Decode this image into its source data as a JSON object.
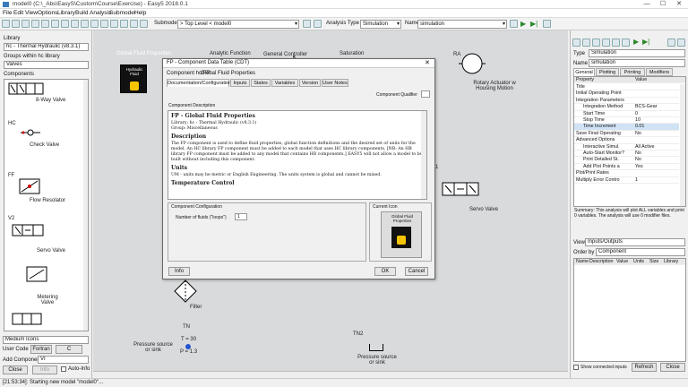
{
  "window": {
    "title": "model0 (C:\\_Abs\\EasyS\\Custom\\Course\\Exercise) - Easy5 2018.0.1",
    "minimize": "—",
    "maximize": "☐",
    "close": "✕"
  },
  "menu": [
    "File",
    "Edit",
    "View",
    "Options",
    "Library",
    "Build",
    "Analysis",
    "Submodel",
    "Help"
  ],
  "toolbar": {
    "submodel_label": "Submodel",
    "submodel_value": "> Top Level < model0",
    "analysis_type_label": "Analysis Type",
    "analysis_type_value": "Simulation",
    "name_label": "Name",
    "name_value": "simulation"
  },
  "left": {
    "library_label": "Library",
    "library_value": "hc - Thermal Hydraulic (v8.3.1)",
    "groups_label": "Groups within hc library",
    "groups_value": "Valves",
    "components_label": "Components",
    "components": [
      {
        "code": "",
        "name": "8-Way Valve"
      },
      {
        "code": "HC",
        "name": "Check Valve"
      },
      {
        "code": "FF",
        "name": "Flow Resolator"
      },
      {
        "code": "V2",
        "name": "Servo Valve"
      },
      {
        "code": "",
        "name": "Metering Valve"
      }
    ],
    "icon_size": "Medium Icons",
    "user_code_label": "User Code",
    "fortran": "Fortran",
    "c": "C",
    "add_component_label": "Add Component",
    "add_component_value": "VI",
    "close": "Close",
    "info": "Info",
    "auto_info": "Auto-Info"
  },
  "canvas": {
    "labels": {
      "analytic": "Analytic Function",
      "general_controller": "General Controller",
      "saturation": "Saturation",
      "hydraulic_fluid_props": "Global Fluid Properties",
      "rotary_actuator": "Rotary Actuator w Housing Motion",
      "servo_valve": "Servo Valve",
      "filter": "Filter",
      "pressure_source_1": "Pressure source or sink",
      "pressure_source_2": "Pressure source or sink",
      "t_value": "T = 30",
      "p_value": "P = 1.3",
      "fp_code": "FP",
      "ra_code": "RA",
      "v1_code": "V1",
      "tn_code": "TN",
      "tn2_code": "TN2",
      "fluid_text": "Hydraulic Fluid"
    }
  },
  "dialog": {
    "title": "FP - Component Data Table (CDT)",
    "component_label": "Component hc/FP",
    "component_name": "Global Fluid Properties",
    "tabs": [
      "Documentation/Configuration",
      "Inputs",
      "States",
      "Variables",
      "Version",
      "User Notes"
    ],
    "qualifier_label": "Component Qualifier",
    "desc_label": "Component Description",
    "desc_heading": "FP - Global Fluid Properties",
    "desc_library": "Library: hc - Thermal Hydraulic (v8.3.1)",
    "desc_group": "Group: Miscellaneous",
    "desc_section": "Description",
    "desc_body": "The FP component is used to define fluid properties, global function definitions and the desired set of units for the model. An HC library FP component must be added to each model that uses HC library components. [NB: An HB library FP component must be added to any model that contains HB components.] EASY5 will not allow a model to be built without including this component.",
    "desc_units_section": "Units",
    "desc_units": "UM - units may be metric or English Engineering. The units system is global and cannot be mixed.",
    "desc_temp": "Temperature Control",
    "config_label": "Component Configuration",
    "num_fluids_label": "Number of fluids (\"loops\")",
    "num_fluids_value": "1",
    "current_icon_label": "Current Icon",
    "icon_caption": "Global Fluid Properties",
    "info": "Info",
    "ok": "OK",
    "cancel": "Cancel"
  },
  "right": {
    "type_label": "Type",
    "type_value": "Simulation",
    "name_label": "Name",
    "name_value": "simulation",
    "tabs": [
      "General",
      "Plotting",
      "Printing",
      "Modifiers"
    ],
    "col_property": "Property",
    "col_value": "Value",
    "rows": [
      {
        "p": "Title",
        "v": ""
      },
      {
        "p": "Initial Operating Point",
        "v": ""
      },
      {
        "p": "Integration Parameters",
        "v": ""
      },
      {
        "p": "Integration Method",
        "v": "BCS-Gear"
      },
      {
        "p": "Start Time",
        "v": "0"
      },
      {
        "p": "Stop Time",
        "v": "10"
      },
      {
        "p": "Time Increment",
        "v": "0.01"
      },
      {
        "p": "Save Final Operating",
        "v": "No"
      },
      {
        "p": "Advanced Options",
        "v": ""
      },
      {
        "p": "Interactive Simul.",
        "v": "All Active"
      },
      {
        "p": "Auto-Start Monitor?",
        "v": "No"
      },
      {
        "p": "Print Detailed St.",
        "v": "No"
      },
      {
        "p": "Add Plot Points a",
        "v": "Yes"
      },
      {
        "p": "Plot/Print Rates",
        "v": ""
      },
      {
        "p": "Multiply Error Contro",
        "v": "1"
      }
    ],
    "summary": "Summary: This analysis will plot ALL variables and print 0 variables. The analysis will use 0 modifier files.",
    "view_label": "View",
    "view_value": "Inputs/Outputs",
    "order_label": "Order by",
    "order_value": "Component",
    "io_cols": [
      "Name",
      "Description",
      "Value",
      "Units",
      "Size",
      "Library"
    ],
    "show_connected": "Show connected inputs",
    "refresh": "Refresh",
    "close": "Close"
  },
  "status": "[21:53:34]: Starting new model \"model0\"..."
}
